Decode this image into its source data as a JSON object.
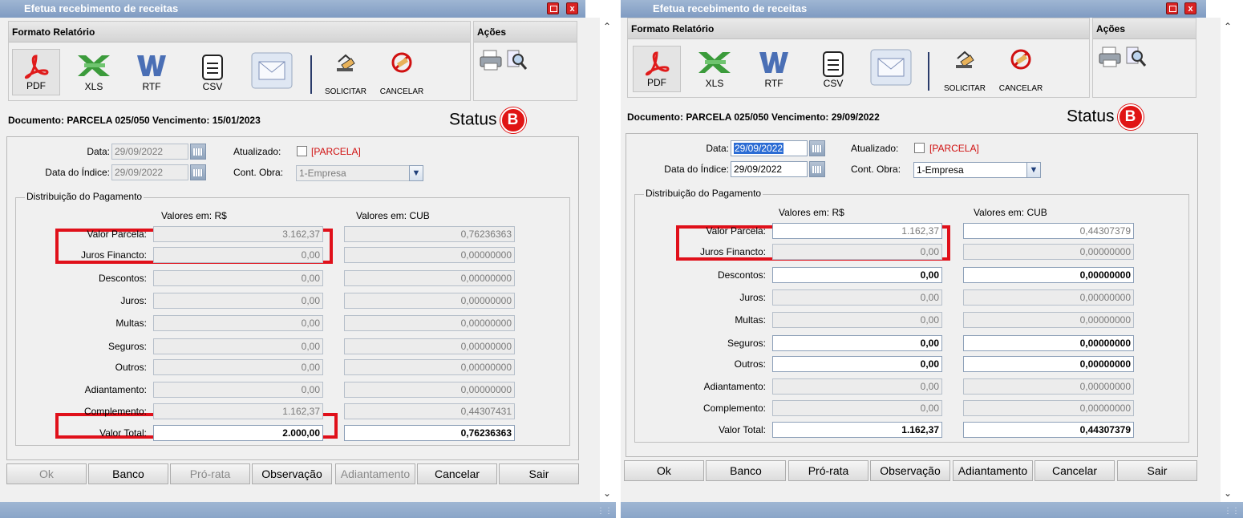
{
  "window": {
    "title": "Efetua recebimento de receitas"
  },
  "toolbar": {
    "formato_title": "Formato Relatório",
    "acoes_title": "Ações",
    "formats": [
      "PDF",
      "XLS",
      "RTF",
      "CSV"
    ],
    "solicitar": "SOLICITAR",
    "cancelar": "CANCELAR"
  },
  "labels": {
    "data": "Data:",
    "data_indice": "Data do Índice:",
    "atualizado": "Atualizado:",
    "parcela_tag": "[PARCELA]",
    "cont_obra": "Cont. Obra:",
    "distribuicao": "Distribuição do Pagamento",
    "col_rs": "Valores em: R$",
    "col_cub": "Valores em: CUB",
    "status": "Status",
    "status_badge": "B"
  },
  "rows": [
    "Valor Parcela:",
    "Juros Financto:",
    "Descontos:",
    "Juros:",
    "Multas:",
    "Seguros:",
    "Outros:",
    "Adiantamento:",
    "Complemento:",
    "Valor Total:"
  ],
  "buttons": [
    "Ok",
    "Banco",
    "Pró-rata",
    "Observação",
    "Adiantamento",
    "Cancelar",
    "Sair"
  ],
  "left": {
    "documento": "Documento: PARCELA 025/050 Vencimento: 15/01/2023",
    "data": "29/09/2022",
    "data_indice": "29/09/2022",
    "cont_obra": "1-Empresa",
    "rs": [
      "3.162,37",
      "0,00",
      "0,00",
      "0,00",
      "0,00",
      "0,00",
      "0,00",
      "0,00",
      "1.162,37",
      "2.000,00"
    ],
    "cub": [
      "0,76236363",
      "0,00000000",
      "0,00000000",
      "0,00000000",
      "0,00000000",
      "0,00000000",
      "0,00000000",
      "0,00000000",
      "0,44307431",
      "0,76236363"
    ]
  },
  "right": {
    "documento": "Documento: PARCELA 025/050 Vencimento: 29/09/2022",
    "data": "29/09/2022",
    "data_indice": "29/09/2022",
    "cont_obra": "1-Empresa",
    "rs": [
      "1.162,37",
      "0,00",
      "0,00",
      "0,00",
      "0,00",
      "0,00",
      "0,00",
      "0,00",
      "0,00",
      "1.162,37"
    ],
    "cub": [
      "0,44307379",
      "0,00000000",
      "0,00000000",
      "0,00000000",
      "0,00000000",
      "0,00000000",
      "0,00000000",
      "0,00000000",
      "0,00000000",
      "0,44307379"
    ]
  },
  "colors": {
    "title_bar": "#8fa8c9",
    "highlight_box": "#e0101a",
    "status_badge": "#e01414"
  }
}
